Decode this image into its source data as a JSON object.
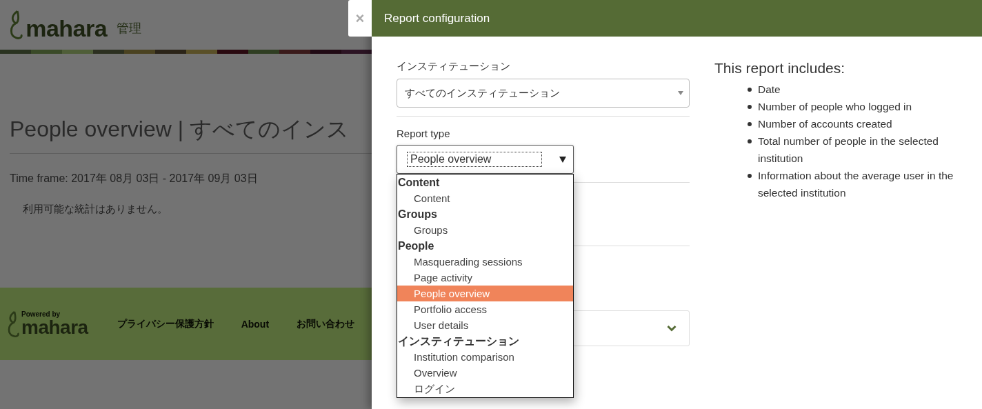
{
  "background_page": {
    "logo_text": "mahara",
    "header_label": "管理",
    "title": "People overview | すべてのインス",
    "time_frame": "Time frame: 2017年 08月 03日 - 2017年 09月 03日",
    "message": "利用可能な統計はありません。",
    "footer": {
      "powered_by": "Powered by",
      "logo_text": "mahara",
      "links": [
        "プライバシー保護方針",
        "About",
        "お問い合わせ"
      ]
    }
  },
  "close_button": "×",
  "drawer": {
    "title": "Report configuration",
    "institution_field": {
      "label": "インスティテューション",
      "value": "すべてのインスティテューション"
    },
    "report_type_field": {
      "label": "Report type",
      "value": "People overview",
      "expanded": true,
      "groups": [
        {
          "label": "Content",
          "options": [
            {
              "label": "Content",
              "selected": false
            }
          ]
        },
        {
          "label": "Groups",
          "options": [
            {
              "label": "Groups",
              "selected": false
            }
          ]
        },
        {
          "label": "People",
          "options": [
            {
              "label": "Masquerading sessions",
              "selected": false
            },
            {
              "label": "Page activity",
              "selected": false
            },
            {
              "label": "People overview",
              "selected": true
            },
            {
              "label": "Portfolio access",
              "selected": false
            },
            {
              "label": "User details",
              "selected": false
            }
          ]
        },
        {
          "label": "インスティテューション",
          "options": [
            {
              "label": "Institution comparison",
              "selected": false
            },
            {
              "label": "Overview",
              "selected": false
            },
            {
              "label": "ログイン",
              "selected": false
            }
          ]
        }
      ]
    },
    "includes": {
      "heading": "This report includes:",
      "items": [
        "Date",
        "Number of people who logged in",
        "Number of accounts created",
        "Total number of people in the selected institution",
        "Information about the average user in the selected institution"
      ]
    }
  }
}
